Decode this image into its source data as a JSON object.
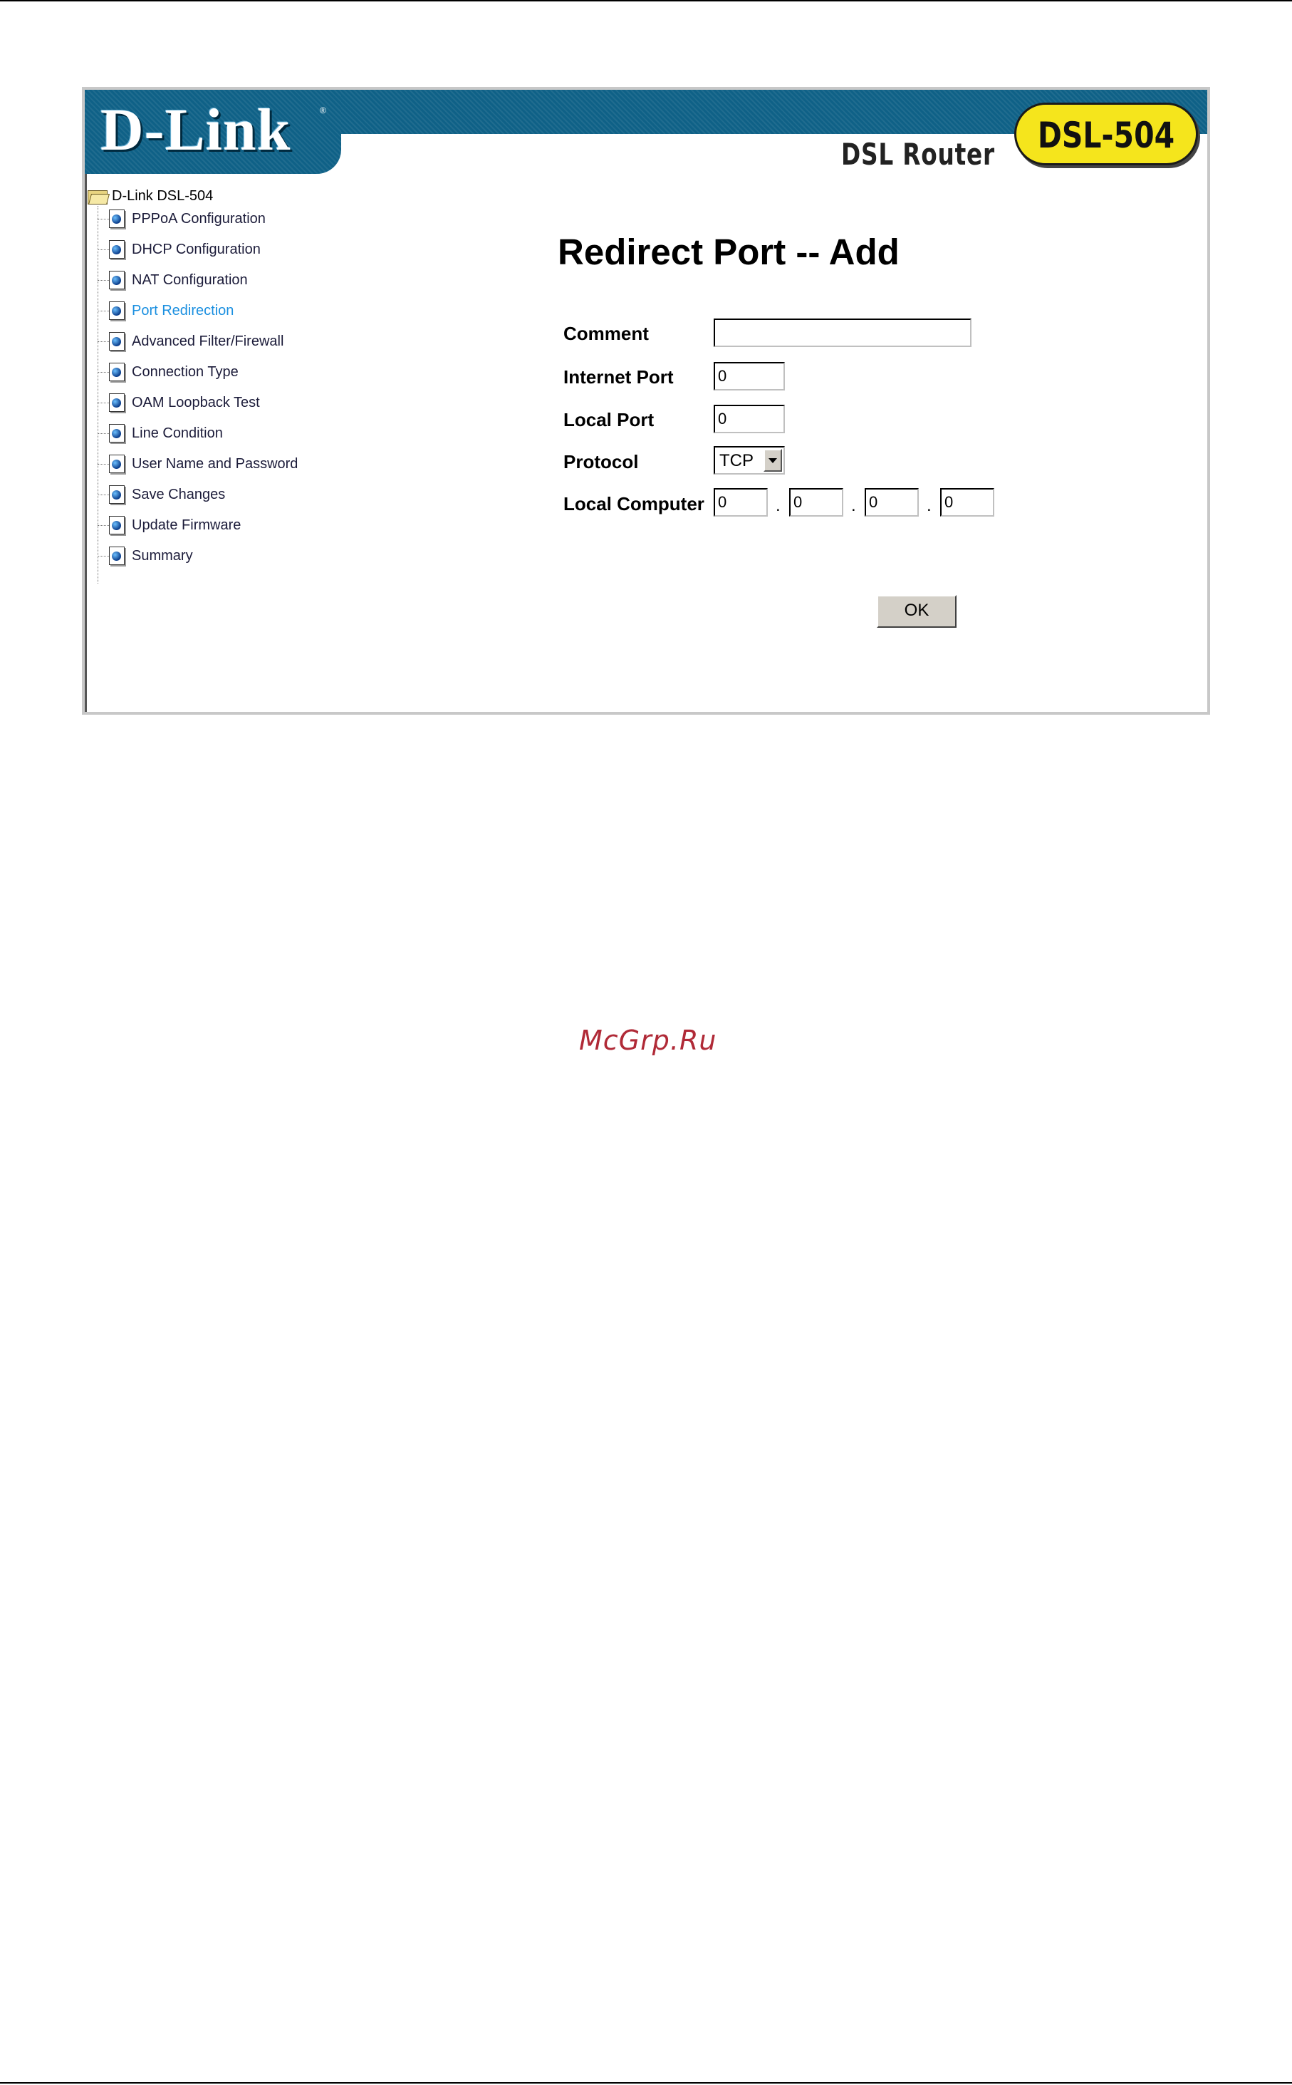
{
  "header": {
    "brand": "D-Link",
    "brand_mark": "®",
    "product_name": "DSL Router",
    "model_badge": "DSL-504"
  },
  "sidebar": {
    "root_label": "D-Link DSL-504",
    "root_icon": "folder-icon",
    "items": [
      {
        "label": "PPPoA Configuration",
        "icon": "page-icon"
      },
      {
        "label": "DHCP Configuration",
        "icon": "page-icon"
      },
      {
        "label": "NAT Configuration",
        "icon": "page-icon"
      },
      {
        "label": "Port Redirection",
        "icon": "page-icon",
        "active": true
      },
      {
        "label": "Advanced Filter/Firewall",
        "icon": "page-icon"
      },
      {
        "label": "Connection Type",
        "icon": "page-icon"
      },
      {
        "label": "OAM Loopback Test",
        "icon": "page-icon"
      },
      {
        "label": "Line Condition",
        "icon": "page-icon"
      },
      {
        "label": "User Name and Password",
        "icon": "page-icon"
      },
      {
        "label": "Save Changes",
        "icon": "page-icon"
      },
      {
        "label": "Update Firmware",
        "icon": "page-icon"
      },
      {
        "label": "Summary",
        "icon": "page-icon"
      }
    ]
  },
  "form": {
    "title": "Redirect Port -- Add",
    "comment_label": "Comment",
    "comment_value": "",
    "internet_port_label": "Internet Port",
    "internet_port_value": "0",
    "local_port_label": "Local Port",
    "local_port_value": "0",
    "protocol_label": "Protocol",
    "protocol_value": "TCP",
    "local_computer_label": "Local Computer",
    "ip_octets": [
      "0",
      "0",
      "0",
      "0"
    ],
    "ip_separator": ".",
    "ok_label": "OK"
  },
  "watermark": "McGrp.Ru",
  "colors": {
    "banner": "#0f6187",
    "badge": "#f5e51c",
    "active_link": "#1a8fe0",
    "watermark": "#b02a37"
  }
}
